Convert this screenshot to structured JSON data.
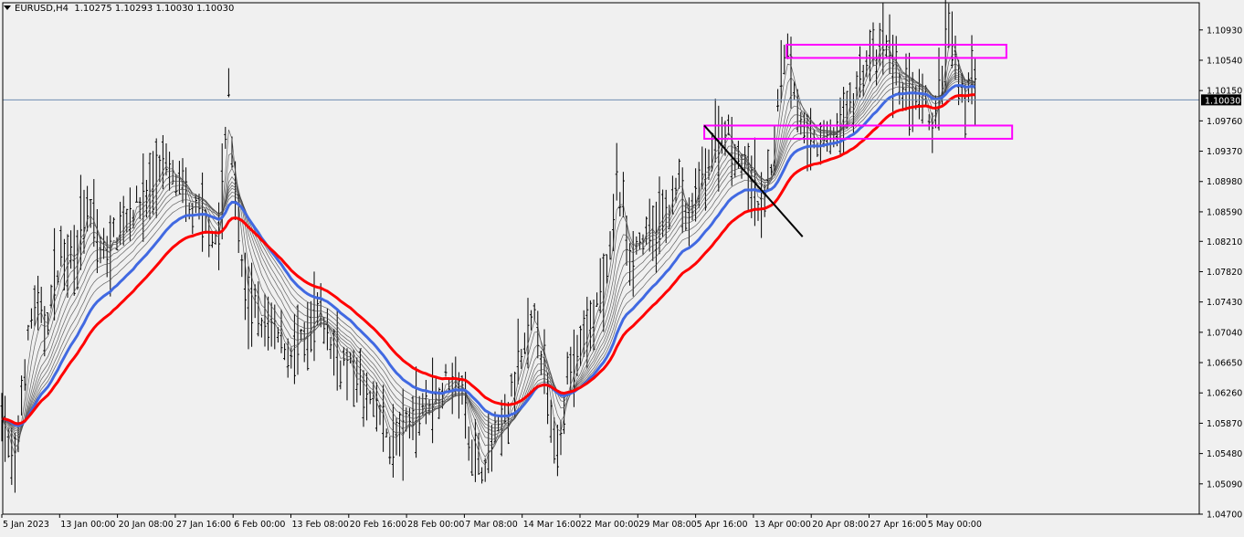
{
  "header": {
    "symbol": "EURUSD,H4",
    "ohlc": "1.10275 1.10293 1.10030 1.10030"
  },
  "colors": {
    "background": "#f0f0f0",
    "candles": "#000000",
    "ma_fast": "#4169e1",
    "ma_slow": "#ff0000",
    "ribbon": "#4a4a4a",
    "boxes": "#ff00ff",
    "price_line": "#6f8db3",
    "trendline": "#000000"
  },
  "chart_data": {
    "type": "line",
    "title": "EURUSD,H4",
    "xlabel": "",
    "ylabel": "",
    "ylim": [
      1.047,
      1.1128
    ],
    "y_ticks": [
      "1.10930",
      "1.10540",
      "1.10150",
      "1.09760",
      "1.09370",
      "1.08980",
      "1.08590",
      "1.08210",
      "1.07820",
      "1.07430",
      "1.07040",
      "1.06650",
      "1.06260",
      "1.05870",
      "1.05480",
      "1.05090",
      "1.04700"
    ],
    "x_ticks": [
      "5 Jan 2023",
      "13 Jan 00:00",
      "20 Jan 08:00",
      "27 Jan 16:00",
      "6 Feb 00:00",
      "13 Feb 08:00",
      "20 Feb 16:00",
      "28 Feb 00:00",
      "7 Mar 08:00",
      "14 Mar 16:00",
      "22 Mar 00:00",
      "29 Mar 08:00",
      "5 Apr 16:00",
      "13 Apr 00:00",
      "20 Apr 08:00",
      "27 Apr 16:00",
      "5 May 00:00"
    ],
    "current_price": "1.10030",
    "grid": false,
    "price_path": [
      [
        0,
        1.0608
      ],
      [
        0.4,
        1.056
      ],
      [
        0.9,
        1.052
      ],
      [
        1.5,
        1.065
      ],
      [
        2.2,
        1.074
      ],
      [
        3,
        1.071
      ],
      [
        4,
        1.08
      ],
      [
        5,
        1.081
      ],
      [
        6,
        1.086
      ],
      [
        7,
        1.08
      ],
      [
        8.5,
        1.085
      ],
      [
        10,
        1.088
      ],
      [
        11,
        1.092
      ],
      [
        12,
        1.09
      ],
      [
        13,
        1.086
      ],
      [
        14,
        1.085
      ],
      [
        15,
        1.082
      ],
      [
        15.4,
        1.093
      ],
      [
        15.7,
        1.102
      ],
      [
        16,
        1.092
      ],
      [
        16.5,
        1.08
      ],
      [
        17,
        1.074
      ],
      [
        18,
        1.072
      ],
      [
        19,
        1.07
      ],
      [
        20,
        1.068
      ],
      [
        21,
        1.069
      ],
      [
        22,
        1.073
      ],
      [
        23,
        1.068
      ],
      [
        24,
        1.066
      ],
      [
        25,
        1.063
      ],
      [
        26,
        1.06
      ],
      [
        27,
        1.056
      ],
      [
        28,
        1.058
      ],
      [
        29,
        1.061
      ],
      [
        30,
        1.062
      ],
      [
        31,
        1.065
      ],
      [
        32,
        1.062
      ],
      [
        32.5,
        1.056
      ],
      [
        33,
        1.053
      ],
      [
        34,
        1.056
      ],
      [
        35,
        1.06
      ],
      [
        36,
        1.067
      ],
      [
        37,
        1.073
      ],
      [
        37.5,
        1.065
      ],
      [
        38,
        1.058
      ],
      [
        38.5,
        1.056
      ],
      [
        39,
        1.064
      ],
      [
        40,
        1.068
      ],
      [
        41,
        1.073
      ],
      [
        42,
        1.078
      ],
      [
        42.5,
        1.09
      ],
      [
        43,
        1.086
      ],
      [
        43.5,
        1.08
      ],
      [
        44,
        1.082
      ],
      [
        45,
        1.083
      ],
      [
        46,
        1.086
      ],
      [
        47,
        1.09
      ],
      [
        47.5,
        1.083
      ],
      [
        48,
        1.088
      ],
      [
        49,
        1.093
      ],
      [
        50,
        1.097
      ],
      [
        51,
        1.093
      ],
      [
        52,
        1.089
      ],
      [
        52.5,
        1.086
      ],
      [
        53,
        1.09
      ],
      [
        53.5,
        1.095
      ],
      [
        54,
        1.106
      ],
      [
        54.5,
        1.107
      ],
      [
        55,
        1.1
      ],
      [
        55.5,
        1.096
      ],
      [
        56,
        1.094
      ],
      [
        57,
        1.095
      ],
      [
        58,
        1.097
      ],
      [
        59,
        1.101
      ],
      [
        60,
        1.106
      ],
      [
        60.5,
        1.105
      ],
      [
        61,
        1.108
      ],
      [
        62,
        1.103
      ],
      [
        63,
        1.1
      ],
      [
        64,
        1.099
      ],
      [
        64.5,
        1.096
      ],
      [
        65,
        1.103
      ],
      [
        65.5,
        1.109
      ],
      [
        66,
        1.105
      ],
      [
        66.5,
        1.099
      ],
      [
        67,
        1.104
      ],
      [
        67.6,
        1.1003
      ]
    ],
    "boxes": [
      {
        "x0": 54.3,
        "x1": 69.5,
        "y0": 1.1057,
        "y1": 1.1074
      },
      {
        "x0": 48.6,
        "x1": 69.9,
        "y0": 1.0953,
        "y1": 1.097
      }
    ],
    "trendline": {
      "x0": 48.6,
      "x1": 55.4,
      "y0": 1.097,
      "y1": 1.0827
    }
  }
}
